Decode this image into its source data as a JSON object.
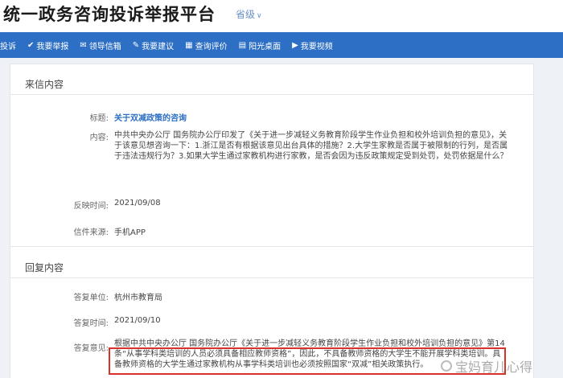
{
  "header": {
    "site_title": "统一政务咨询投诉举报平台",
    "province_label": "省级"
  },
  "nav": [
    {
      "label": "投诉",
      "icon": ""
    },
    {
      "label": "我要举报",
      "icon": "✔"
    },
    {
      "label": "领导信箱",
      "icon": "✉"
    },
    {
      "label": "我要建议",
      "icon": "✎"
    },
    {
      "label": "查询评价",
      "icon": "▦"
    },
    {
      "label": "阳光桌面",
      "icon": "▤"
    },
    {
      "label": "我要视频",
      "icon": "▶"
    }
  ],
  "letter": {
    "section_title": "来信内容",
    "subject_label": "标题:",
    "subject": "关于双减政策的咨询",
    "content_label": "内容:",
    "content": "中共中央办公厅 国务院办公厅印发了《关于进一步减轻义务教育阶段学生作业负担和校外培训负担的意见》，关于该意见想咨询一下：1.浙江是否有根据该意见出台具体的措施？2.大学生家教是否属于被限制的行列，是否属于违法违规行为？3.如果大学生通过家教机构进行家教，是否会因为违反政策规定受到处罚，处罚依据是什么？",
    "time_label": "反映时间:",
    "time": "2021/09/08",
    "source_label": "信件来源:",
    "source": "手机APP"
  },
  "reply": {
    "section_title": "回复内容",
    "unit_label": "答复单位:",
    "unit": "杭州市教育局",
    "time_label": "答复时间:",
    "time": "2021/09/10",
    "opinion_label": "答复意见:",
    "opinion": "根据中共中央办公厅 国务院办公厅《关于进一步减轻义务教育阶段学生作业负担和校外培训负担的意见》第14条“从事学科类培训的人员必须具备相应教师资格”，因此，不具备教师资格的大学生不能开展学科类培训。具备教师资格的大学生通过家教机构从事学科类培训也必须按照国家“双减”相关政策执行。"
  },
  "watermark": {
    "text": "宝妈育儿心得"
  },
  "colors": {
    "nav_bg": "#2c6fc4",
    "subject": "#2c6fc4",
    "highlight_border": "#d9322a"
  }
}
